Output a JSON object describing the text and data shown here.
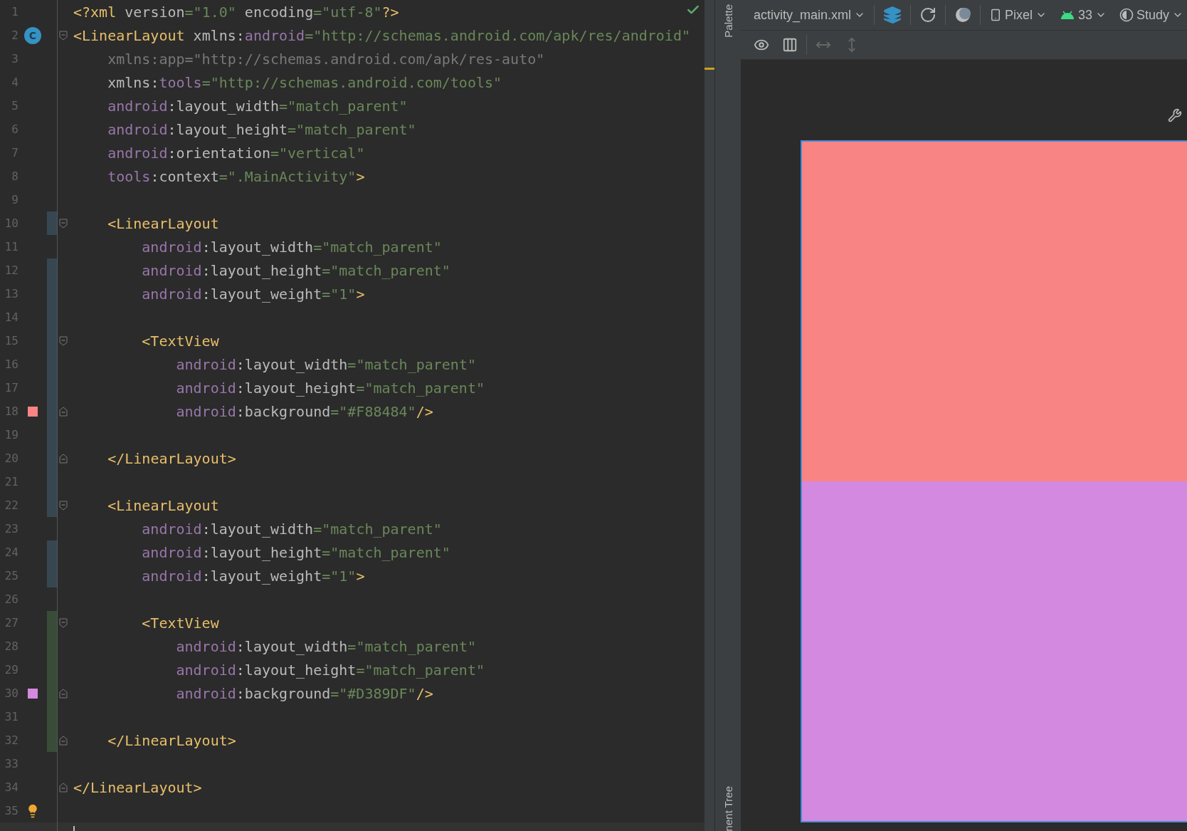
{
  "editor": {
    "lines": [
      {
        "number": "1",
        "current": false,
        "tokens": [
          {
            "kind": "tag",
            "text": "<?xml"
          },
          {
            "kind": "plain",
            "text": " version"
          },
          {
            "kind": "value",
            "text": "=\"1.0\""
          },
          {
            "kind": "plain",
            "text": " encoding"
          },
          {
            "kind": "value",
            "text": "=\"utf-8\""
          },
          {
            "kind": "tag",
            "text": "?>"
          }
        ]
      },
      {
        "number": "2",
        "current": false,
        "marker": {
          "kind": "class",
          "text": "C"
        },
        "fold": {
          "kind": "start"
        },
        "tokens": [
          {
            "kind": "tag",
            "text": "<LinearLayout"
          },
          {
            "kind": "plain",
            "text": " xmlns:"
          },
          {
            "kind": "ns",
            "text": "android"
          },
          {
            "kind": "value",
            "text": "=\"http://schemas.android.com/apk/res/android\""
          }
        ]
      },
      {
        "number": "3",
        "current": false,
        "tokens": [
          {
            "kind": "dim",
            "text": "    xmlns:app=\"http://schemas.android.com/apk/res-auto\""
          }
        ]
      },
      {
        "number": "4",
        "current": false,
        "tokens": [
          {
            "kind": "plain",
            "text": "    xmlns:"
          },
          {
            "kind": "ns",
            "text": "tools"
          },
          {
            "kind": "value",
            "text": "=\"http://schemas.android.com/tools\""
          }
        ]
      },
      {
        "number": "5",
        "current": false,
        "tokens": [
          {
            "kind": "ns",
            "text": "    android"
          },
          {
            "kind": "plain",
            "text": ":layout_width"
          },
          {
            "kind": "value",
            "text": "=\"match_parent\""
          }
        ]
      },
      {
        "number": "6",
        "current": false,
        "tokens": [
          {
            "kind": "ns",
            "text": "    android"
          },
          {
            "kind": "plain",
            "text": ":layout_height"
          },
          {
            "kind": "value",
            "text": "=\"match_parent\""
          }
        ]
      },
      {
        "number": "7",
        "current": false,
        "tokens": [
          {
            "kind": "ns",
            "text": "    android"
          },
          {
            "kind": "plain",
            "text": ":orientation"
          },
          {
            "kind": "value",
            "text": "=\"vertical\""
          }
        ]
      },
      {
        "number": "8",
        "current": false,
        "tokens": [
          {
            "kind": "ns",
            "text": "    tools"
          },
          {
            "kind": "plain",
            "text": ":context"
          },
          {
            "kind": "value",
            "text": "=\".MainActivity\""
          },
          {
            "kind": "tag",
            "text": ">"
          }
        ]
      },
      {
        "number": "9",
        "current": false
      },
      {
        "number": "10",
        "current": false,
        "fold": {
          "kind": "start"
        },
        "change": {
          "kind": "modified"
        },
        "tokens": [
          {
            "kind": "tag",
            "text": "    <LinearLayout"
          }
        ]
      },
      {
        "number": "11",
        "current": false,
        "tokens": [
          {
            "kind": "ns",
            "text": "        android"
          },
          {
            "kind": "plain",
            "text": ":layout_width"
          },
          {
            "kind": "value",
            "text": "=\"match_parent\""
          }
        ]
      },
      {
        "number": "12",
        "current": false,
        "change": {
          "kind": "modified"
        },
        "tokens": [
          {
            "kind": "ns",
            "text": "        android"
          },
          {
            "kind": "plain",
            "text": ":layout_height"
          },
          {
            "kind": "value",
            "text": "=\"match_parent\""
          }
        ]
      },
      {
        "number": "13",
        "current": false,
        "change": {
          "kind": "modified"
        },
        "tokens": [
          {
            "kind": "ns",
            "text": "        android"
          },
          {
            "kind": "plain",
            "text": ":layout_weight"
          },
          {
            "kind": "value",
            "text": "=\"1\""
          },
          {
            "kind": "tag",
            "text": ">"
          }
        ]
      },
      {
        "number": "14",
        "current": false,
        "change": {
          "kind": "modified"
        }
      },
      {
        "number": "15",
        "current": false,
        "fold": {
          "kind": "start"
        },
        "change": {
          "kind": "modified"
        },
        "tokens": [
          {
            "kind": "tag",
            "text": "        <TextView"
          }
        ]
      },
      {
        "number": "16",
        "current": false,
        "change": {
          "kind": "modified"
        },
        "tokens": [
          {
            "kind": "ns",
            "text": "            android"
          },
          {
            "kind": "plain",
            "text": ":layout_width"
          },
          {
            "kind": "value",
            "text": "=\"match_parent\""
          }
        ]
      },
      {
        "number": "17",
        "current": false,
        "change": {
          "kind": "modified"
        },
        "tokens": [
          {
            "kind": "ns",
            "text": "            android"
          },
          {
            "kind": "plain",
            "text": ":layout_height"
          },
          {
            "kind": "value",
            "text": "=\"match_parent\""
          }
        ]
      },
      {
        "number": "18",
        "current": false,
        "marker": {
          "kind": "swatch",
          "color": "#f88484"
        },
        "fold": {
          "kind": "end"
        },
        "change": {
          "kind": "modified"
        },
        "tokens": [
          {
            "kind": "ns",
            "text": "            android"
          },
          {
            "kind": "plain",
            "text": ":background"
          },
          {
            "kind": "value",
            "text": "=\"#F88484\""
          },
          {
            "kind": "tag",
            "text": "/>"
          }
        ]
      },
      {
        "number": "19",
        "current": false,
        "change": {
          "kind": "modified"
        }
      },
      {
        "number": "20",
        "current": false,
        "fold": {
          "kind": "end"
        },
        "change": {
          "kind": "modified"
        },
        "tokens": [
          {
            "kind": "tag",
            "text": "    </LinearLayout>"
          }
        ]
      },
      {
        "number": "21",
        "current": false,
        "change": {
          "kind": "modified"
        }
      },
      {
        "number": "22",
        "current": false,
        "fold": {
          "kind": "start"
        },
        "change": {
          "kind": "modified"
        },
        "tokens": [
          {
            "kind": "tag",
            "text": "    <LinearLayout"
          }
        ]
      },
      {
        "number": "23",
        "current": false,
        "tokens": [
          {
            "kind": "ns",
            "text": "        android"
          },
          {
            "kind": "plain",
            "text": ":layout_width"
          },
          {
            "kind": "value",
            "text": "=\"match_parent\""
          }
        ]
      },
      {
        "number": "24",
        "current": false,
        "change": {
          "kind": "modified"
        },
        "tokens": [
          {
            "kind": "ns",
            "text": "        android"
          },
          {
            "kind": "plain",
            "text": ":layout_height"
          },
          {
            "kind": "value",
            "text": "=\"match_parent\""
          }
        ]
      },
      {
        "number": "25",
        "current": false,
        "change": {
          "kind": "modified"
        },
        "tokens": [
          {
            "kind": "ns",
            "text": "        android"
          },
          {
            "kind": "plain",
            "text": ":layout_weight"
          },
          {
            "kind": "value",
            "text": "=\"1\""
          },
          {
            "kind": "tag",
            "text": ">"
          }
        ]
      },
      {
        "number": "26",
        "current": false
      },
      {
        "number": "27",
        "current": false,
        "fold": {
          "kind": "start"
        },
        "change": {
          "kind": "added"
        },
        "tokens": [
          {
            "kind": "tag",
            "text": "        <TextView"
          }
        ]
      },
      {
        "number": "28",
        "current": false,
        "change": {
          "kind": "added"
        },
        "tokens": [
          {
            "kind": "ns",
            "text": "            android"
          },
          {
            "kind": "plain",
            "text": ":layout_width"
          },
          {
            "kind": "value",
            "text": "=\"match_parent\""
          }
        ]
      },
      {
        "number": "29",
        "current": false,
        "change": {
          "kind": "added"
        },
        "tokens": [
          {
            "kind": "ns",
            "text": "            android"
          },
          {
            "kind": "plain",
            "text": ":layout_height"
          },
          {
            "kind": "value",
            "text": "=\"match_parent\""
          }
        ]
      },
      {
        "number": "30",
        "current": false,
        "marker": {
          "kind": "swatch",
          "color": "#d389df"
        },
        "fold": {
          "kind": "end"
        },
        "change": {
          "kind": "added"
        },
        "tokens": [
          {
            "kind": "ns",
            "text": "            android"
          },
          {
            "kind": "plain",
            "text": ":background"
          },
          {
            "kind": "value",
            "text": "=\"#D389DF\""
          },
          {
            "kind": "tag",
            "text": "/>"
          }
        ]
      },
      {
        "number": "31",
        "current": false,
        "change": {
          "kind": "added"
        }
      },
      {
        "number": "32",
        "current": false,
        "fold": {
          "kind": "end"
        },
        "change": {
          "kind": "added"
        },
        "tokens": [
          {
            "kind": "tag",
            "text": "    </LinearLayout>"
          }
        ]
      },
      {
        "number": "33",
        "current": false
      },
      {
        "number": "34",
        "current": false,
        "fold": {
          "kind": "end"
        },
        "tokens": [
          {
            "kind": "tag",
            "text": "</LinearLayout>"
          }
        ]
      },
      {
        "number": "35",
        "current": false,
        "marker": {
          "kind": "bulb"
        }
      },
      {
        "current": true
      }
    ]
  },
  "side_tabs": [
    {
      "label": "Palette"
    },
    {
      "label": "nent Tree"
    }
  ],
  "design_toolbar": {
    "file": "activity_main.xml",
    "device": "Pixel",
    "api": "33",
    "theme": "Study"
  },
  "preview": {
    "sections": [
      {
        "color": "#f88484"
      },
      {
        "color": "#d389df"
      }
    ]
  }
}
